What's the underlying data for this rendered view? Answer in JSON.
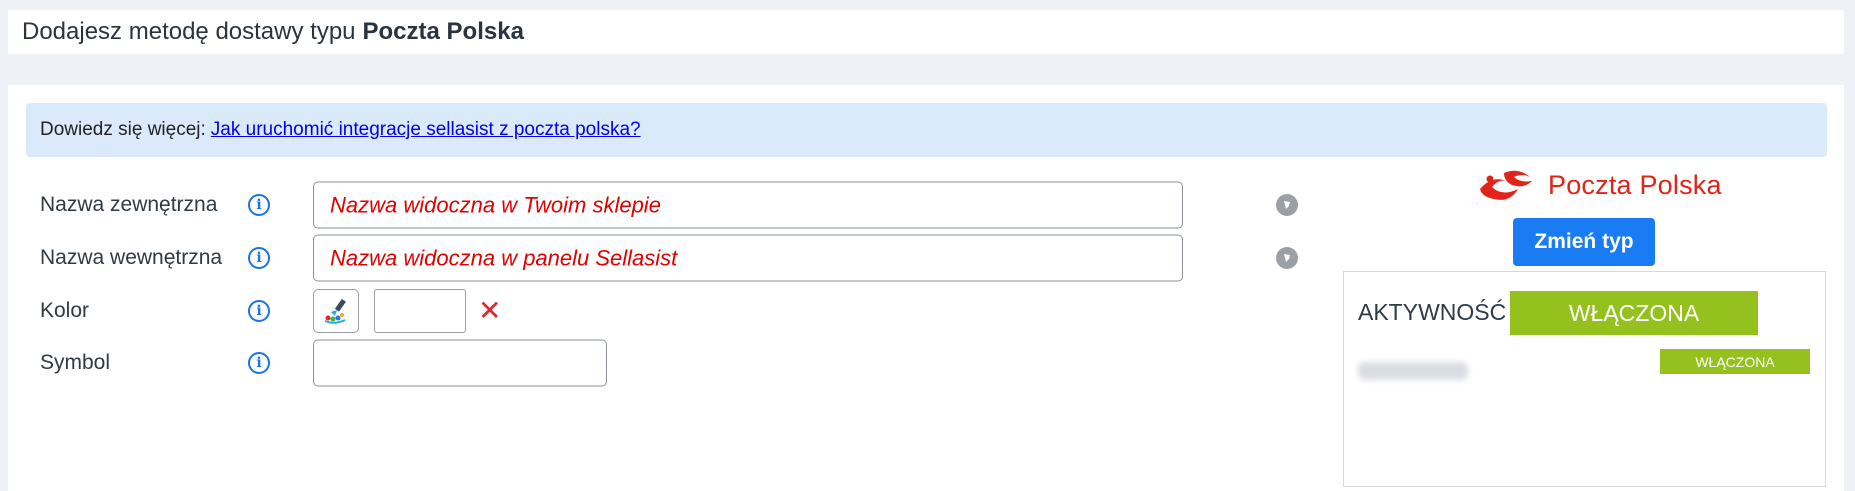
{
  "header": {
    "title_prefix": "Dodajesz metodę dostawy typu",
    "title_type": "Poczta Polska"
  },
  "info": {
    "prefix": "Dowiedz się więcej:",
    "link_text": "Jak uruchomić integracje sellasist z poczta polska?"
  },
  "form": {
    "external_name": {
      "label": "Nazwa zewnętrzna",
      "placeholder": "Nazwa widoczna w Twoim sklepie",
      "value": ""
    },
    "internal_name": {
      "label": "Nazwa wewnętrzna",
      "placeholder": "Nazwa widoczna w panelu Sellasist",
      "value": ""
    },
    "color": {
      "label": "Kolor",
      "value": "",
      "clear_icon": "close-icon"
    },
    "symbol": {
      "label": "Symbol",
      "value": ""
    },
    "info_icon": "info-icon",
    "globe_icon": "globe-icon"
  },
  "sidebar": {
    "logo_text": "Poczta Polska",
    "change_type_label": "Zmień typ",
    "activity_label": "AKTYWNOŚĆ",
    "activity_status": "WŁĄCZONA",
    "shop_status": "WŁĄCZONA"
  },
  "colors": {
    "accent_blue": "#1a7cf2",
    "status_green": "#95c11f",
    "brand_red": "#e2231a",
    "placeholder_red": "#e00000",
    "info_bg": "#dbeafb"
  }
}
